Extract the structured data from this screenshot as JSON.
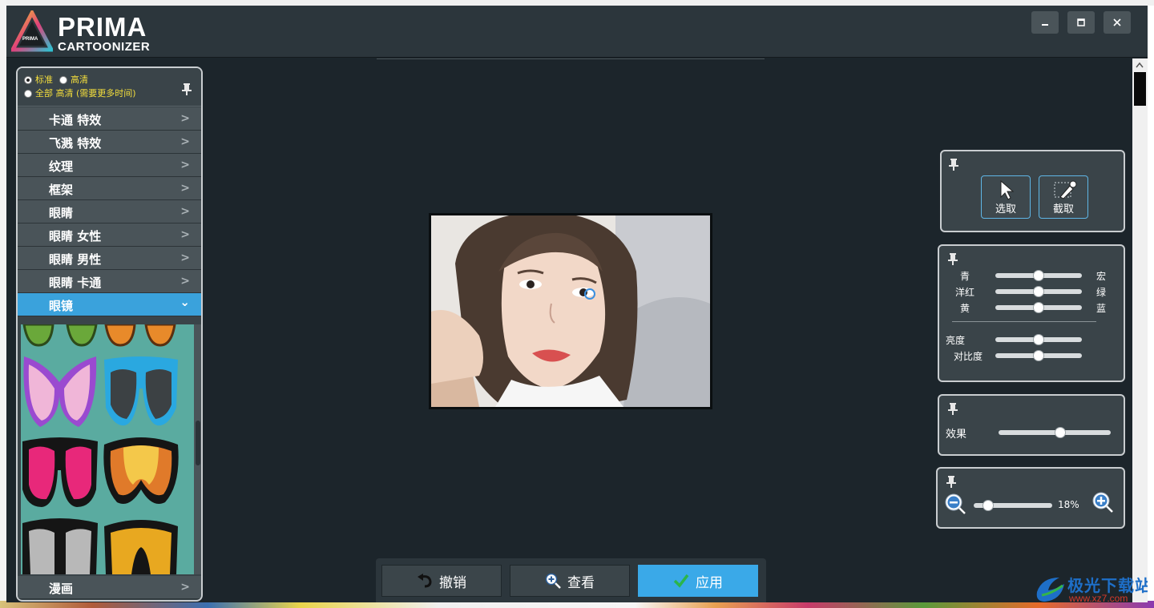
{
  "app": {
    "logo_word": "PRIMA",
    "logo_sub": "CARTOONIZER",
    "logo_badge": "PRIMA"
  },
  "window_controls": {
    "minimize": "🗕",
    "maximize": "🗖",
    "close": "✕"
  },
  "resolution": {
    "options": [
      {
        "label": "标准",
        "selected": true
      },
      {
        "label": "高清",
        "selected": false
      },
      {
        "label": "全部 高清 (需要更多时间)",
        "selected": false
      }
    ]
  },
  "sidebar": {
    "items": [
      {
        "label": "卡通 特效",
        "chevron": ">"
      },
      {
        "label": "飞溅 特效",
        "chevron": ">"
      },
      {
        "label": "纹理",
        "chevron": ">"
      },
      {
        "label": "框架",
        "chevron": ">"
      },
      {
        "label": "眼睛",
        "chevron": ">"
      },
      {
        "label": "眼睛 女性",
        "chevron": ">"
      },
      {
        "label": "眼睛 男性",
        "chevron": ">"
      },
      {
        "label": "眼睛 卡通",
        "chevron": ">"
      },
      {
        "label": "眼镜",
        "chevron": "⌄",
        "active": true
      },
      {
        "label": "漫画",
        "chevron": ">"
      }
    ]
  },
  "tools": {
    "select_label": "选取",
    "crop_label": "截取"
  },
  "color_adjust": {
    "rows": [
      {
        "left": "青",
        "right": "宏",
        "value": 0.5
      },
      {
        "left": "洋红",
        "right": "绿",
        "value": 0.5
      },
      {
        "left": "黄",
        "right": "蓝",
        "value": 0.5
      }
    ],
    "brightness_label": "亮度",
    "brightness_value": 0.5,
    "contrast_label": "对比度",
    "contrast_value": 0.5
  },
  "effect": {
    "label": "效果",
    "value": 0.55
  },
  "zoom": {
    "value_label": "18%",
    "value": 0.18
  },
  "bottom": {
    "undo_label": "撤销",
    "view_label": "查看",
    "apply_label": "应用"
  },
  "watermark": {
    "text": "极光下载站",
    "url": "www.xz7.com"
  },
  "colors": {
    "accent": "#3aa2dc",
    "panel": "#3a4449",
    "canvas": "#1c252b",
    "radio_text": "#f4de3c"
  }
}
